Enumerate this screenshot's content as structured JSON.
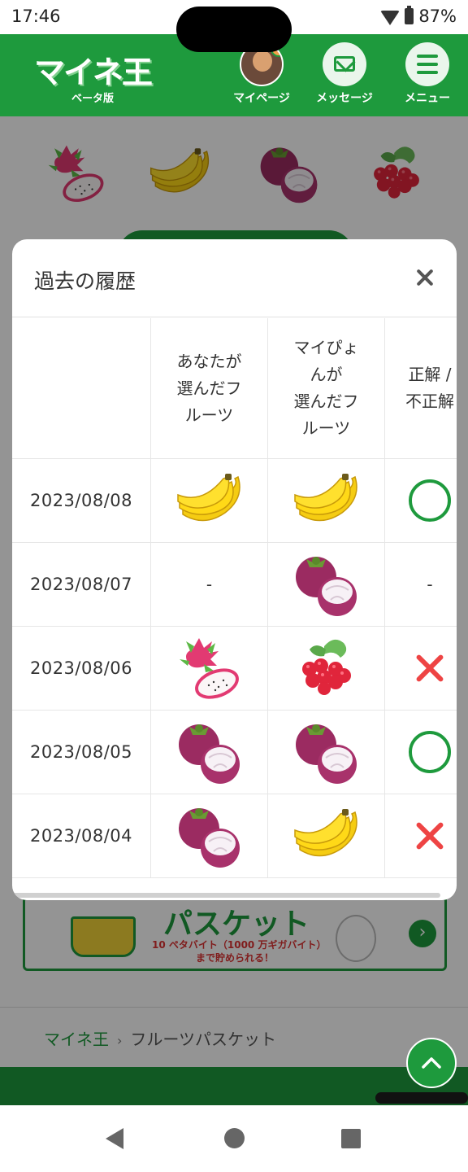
{
  "status_bar": {
    "time": "17:46",
    "battery": "87%"
  },
  "header": {
    "logo": "マイネ王",
    "logo_sub": "ベータ版",
    "nav": [
      {
        "label": "マイページ",
        "icon": "avatar"
      },
      {
        "label": "メッセージ",
        "icon": "mail-icon"
      },
      {
        "label": "メニュー",
        "icon": "menu-icon"
      }
    ]
  },
  "page": {
    "top_fruits": [
      "dragonfruit",
      "banana",
      "mangosteen",
      "raspberry"
    ],
    "banner": {
      "title": "パスケット",
      "sub1": "10 ペタバイト（1000 万ギガバイト）",
      "sub2": "まで貯められる！"
    },
    "breadcrumb": {
      "home": "マイネ王",
      "separator": "›",
      "current": "フルーツパスケット"
    }
  },
  "modal": {
    "title": "過去の履歴",
    "close_icon": "close-icon",
    "columns": [
      "",
      "あなたが\n選んだフ\nルーツ",
      "マイぴょ\nんが\n選んだフ\nルーツ",
      "正解 /\n不正解"
    ],
    "rows": [
      {
        "date": "2023/08/08",
        "yours": "banana",
        "maipyon": "banana",
        "result": "correct"
      },
      {
        "date": "2023/08/07",
        "yours": "-",
        "maipyon": "mangosteen",
        "result": "-"
      },
      {
        "date": "2023/08/06",
        "yours": "dragonfruit",
        "maipyon": "raspberry",
        "result": "incorrect"
      },
      {
        "date": "2023/08/05",
        "yours": "mangosteen",
        "maipyon": "mangosteen",
        "result": "correct"
      },
      {
        "date": "2023/08/04",
        "yours": "mangosteen",
        "maipyon": "banana",
        "result": "incorrect"
      }
    ]
  },
  "colors": {
    "brand_green": "#1e9a3d",
    "wrong_red": "#ee4444",
    "banana": "#f5cc12",
    "mangosteen": "#9b2b61",
    "raspberry": "#e0253b"
  }
}
